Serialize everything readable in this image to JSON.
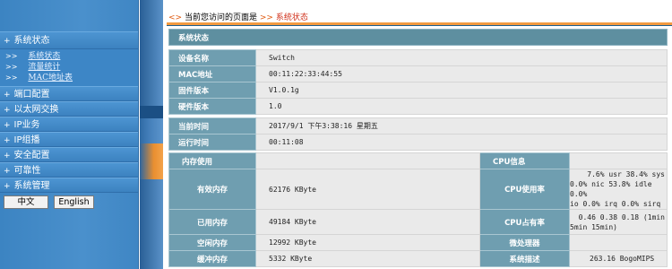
{
  "sidebar": {
    "items": [
      {
        "label": "系统状态",
        "open": true
      },
      {
        "label": "端口配置"
      },
      {
        "label": "以太网交换"
      },
      {
        "label": "IP业务"
      },
      {
        "label": "IP组播"
      },
      {
        "label": "安全配置"
      },
      {
        "label": "可靠性"
      },
      {
        "label": "系统管理"
      }
    ],
    "plus_symbol": "+",
    "sub_arrow": ">>",
    "subitems": [
      "系统状态",
      "流量统计",
      "MAC地址表"
    ],
    "lang": {
      "zh": "中文",
      "en": "English"
    }
  },
  "breadcrumb": {
    "symbol": "<>",
    "prefix": "当前您访问的页面是",
    "sep": ">>",
    "current": "系统状态"
  },
  "status": {
    "title": "系统状态",
    "device": [
      {
        "label": "设备名称",
        "value": "Switch"
      },
      {
        "label": "MAC地址",
        "value": "00:11:22:33:44:55"
      },
      {
        "label": "固件版本",
        "value": "V1.0.1g"
      },
      {
        "label": "硬件版本",
        "value": "1.0"
      }
    ],
    "time": [
      {
        "label": "当前时间",
        "value": "2017/9/1 下午3:38:16 星期五"
      },
      {
        "label": "运行时间",
        "value": "00:11:08"
      }
    ],
    "memory": {
      "header": "内存使用",
      "rows": [
        {
          "label": "有效内存",
          "value": "62176 KByte"
        },
        {
          "label": "已用内存",
          "value": "49184 KByte"
        },
        {
          "label": "空闲内存",
          "value": "12992 KByte"
        },
        {
          "label": "缓冲内存",
          "value": "5332 KByte"
        }
      ]
    },
    "cpu": {
      "header": "CPU信息",
      "rows": [
        {
          "label": "CPU使用率",
          "value_lines": [
            "7.6% usr 38.4% sys",
            "0.0% nic 53.8% idle 0.0%",
            "io 0.0% irq 0.0% sirq"
          ]
        },
        {
          "label": "CPU占有率",
          "value_lines": [
            "0.46 0.38 0.18 (1min",
            "5min 15min)"
          ]
        },
        {
          "label": "微处理器",
          "value_lines": [
            ""
          ]
        },
        {
          "label": "系统描述",
          "value_lines": [
            "263.16 BogoMIPS"
          ]
        }
      ]
    }
  }
}
